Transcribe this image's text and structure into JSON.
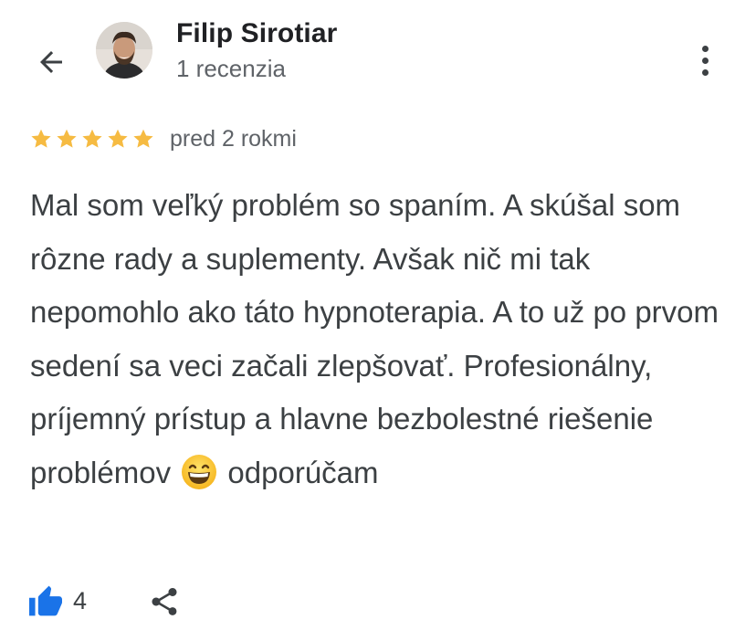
{
  "header": {
    "back_icon": "arrow-left-icon",
    "user_name": "Filip Sirotiar",
    "review_count": "1 recenzia",
    "more_icon": "more-vertical-icon"
  },
  "review": {
    "rating": 5,
    "rating_max": 5,
    "star_color": "#f6bb42",
    "date": "pred 2 rokmi",
    "text_before_emoji": "Mal som veľký problém so spaním. A skúšal som rôzne rady a suplementy. Avšak nič mi tak nepomohlo ako táto hypnoterapia. A to už po prvom sedení sa veci začali zlepšovať. Profesionálny, príjemný prístup a hlavne bezbolestné riešenie problémov",
    "emoji_icon": "grinning-face-emoji-icon",
    "text_after_emoji": "odporúčam"
  },
  "actions": {
    "like_icon": "thumbs-up-icon",
    "like_color": "#1a73e8",
    "like_count": "4",
    "share_icon": "share-icon"
  }
}
